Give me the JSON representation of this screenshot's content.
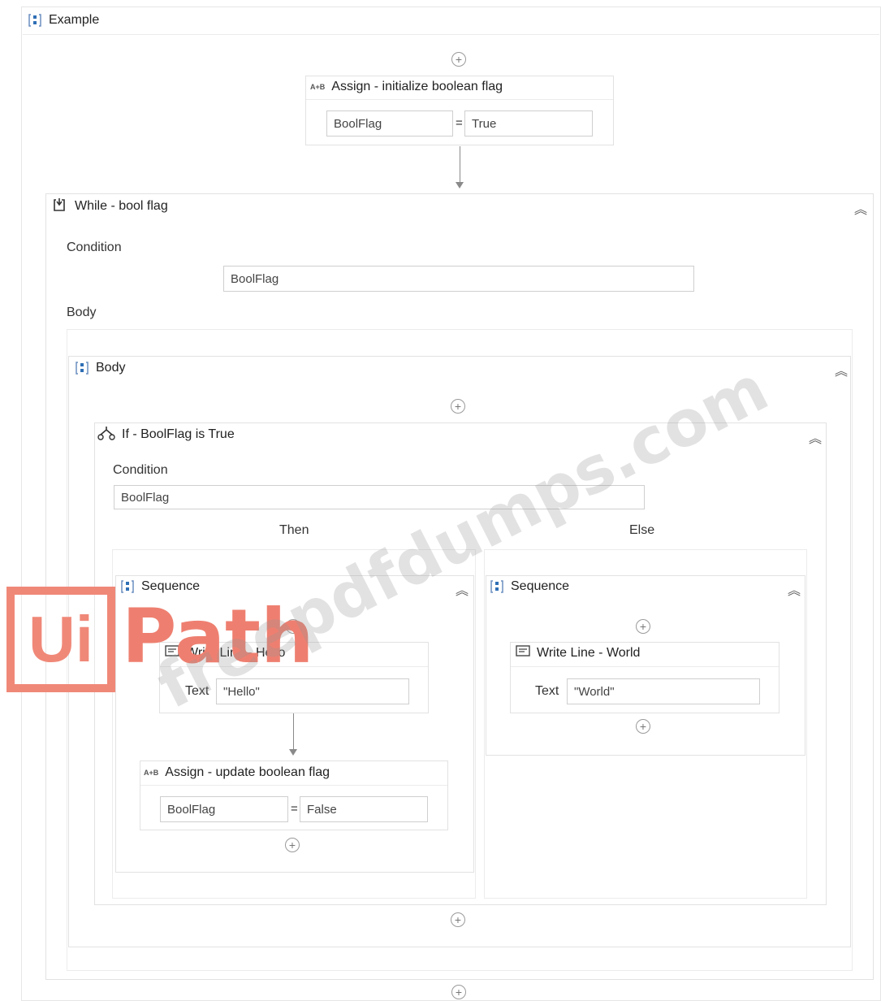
{
  "root": {
    "title": "Example"
  },
  "assign_init": {
    "title": "Assign - initialize boolean flag",
    "left": "BoolFlag",
    "right": "True",
    "eq": "="
  },
  "while": {
    "title": "While - bool flag",
    "condition_label": "Condition",
    "condition_value": "BoolFlag",
    "body_label": "Body"
  },
  "body_seq": {
    "title": "Body"
  },
  "if_block": {
    "title": "If - BoolFlag is True",
    "condition_label": "Condition",
    "condition_value": "BoolFlag",
    "then_label": "Then",
    "else_label": "Else"
  },
  "then_seq": {
    "title": "Sequence",
    "write_line": {
      "title": "Write Line - Hello",
      "text_label": "Text",
      "text_value": "\"Hello\""
    },
    "assign": {
      "title": "Assign - update boolean flag",
      "left": "BoolFlag",
      "right": "False",
      "eq": "="
    }
  },
  "else_seq": {
    "title": "Sequence",
    "write_line": {
      "title": "Write Line - World",
      "text_label": "Text",
      "text_value": "\"World\""
    }
  },
  "icons": {
    "sequence": "sequence-icon",
    "assign": "assign-icon",
    "while": "while-icon",
    "if": "if-icon",
    "write_line": "write-line-icon",
    "add": "add-activity-icon",
    "collapse": "collapse-chevron-icon"
  },
  "watermark": {
    "text": "freepdfdumps.com"
  },
  "logo": {
    "left": "Ui",
    "right": "Path"
  },
  "colors": {
    "accent": "#2f6fb5",
    "logo": "#f08878"
  }
}
